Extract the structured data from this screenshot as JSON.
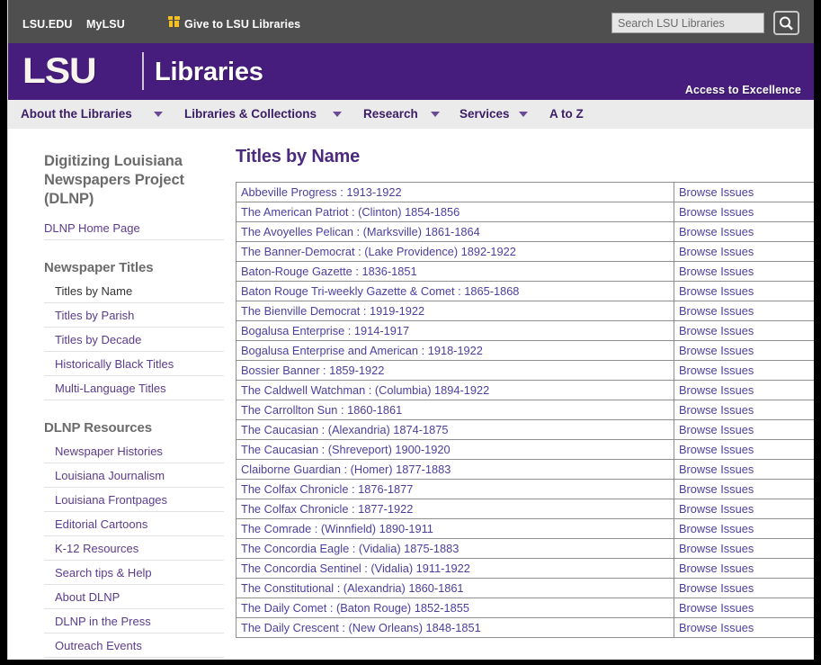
{
  "topbar": {
    "links": [
      {
        "label": "LSU.EDU",
        "name": "lsu-edu-link"
      },
      {
        "label": "MyLSU",
        "name": "mylsu-link"
      },
      {
        "label": "Give to LSU Libraries",
        "name": "give-link"
      }
    ],
    "search": {
      "placeholder": "Search LSU Libraries",
      "value": "",
      "button_icon": "search-icon"
    }
  },
  "brand": {
    "logo_text": "LSU",
    "logo_sub": "Libraries",
    "tagline": "Access to Excellence"
  },
  "mainnav": {
    "items": [
      {
        "label": "About the Libraries",
        "has_caret": true
      },
      {
        "label": "Libraries & Collections",
        "has_caret": true
      },
      {
        "label": "Research",
        "has_caret": true
      },
      {
        "label": "Services",
        "has_caret": true
      },
      {
        "label": "A to Z",
        "has_caret": false
      }
    ]
  },
  "sidebar": {
    "title": "Digitizing Louisiana Newspapers Project (DLNP)",
    "home_link": "DLNP Home Page",
    "groups": [
      {
        "heading": "Newspaper Titles",
        "items": [
          {
            "label": "Titles by Name",
            "active": true
          },
          {
            "label": "Titles by Parish",
            "active": false
          },
          {
            "label": "Titles by Decade",
            "active": false
          },
          {
            "label": "Historically Black Titles",
            "active": false
          },
          {
            "label": "Multi-Language Titles",
            "active": false
          }
        ]
      },
      {
        "heading": "DLNP Resources",
        "items": [
          {
            "label": "Newspaper Histories",
            "active": false
          },
          {
            "label": "Louisiana Journalism",
            "active": false
          },
          {
            "label": "Louisiana Frontpages",
            "active": false
          },
          {
            "label": "Editorial Cartoons",
            "active": false
          },
          {
            "label": "K-12 Resources",
            "active": false
          },
          {
            "label": "Search tips & Help",
            "active": false
          },
          {
            "label": "About DLNP",
            "active": false
          },
          {
            "label": "DLNP in the Press",
            "active": false
          },
          {
            "label": "Outreach Events",
            "active": false
          }
        ]
      }
    ]
  },
  "main": {
    "page_title": "Titles by Name",
    "browse_label": "Browse Issues",
    "rows": [
      {
        "title": "Abbeville Progress : 1913-1922"
      },
      {
        "title": "The American Patriot : (Clinton) 1854-1856"
      },
      {
        "title": "The Avoyelles Pelican : (Marksville) 1861-1864"
      },
      {
        "title": "The Banner-Democrat : (Lake Providence) 1892-1922"
      },
      {
        "title": "Baton-Rouge Gazette : 1836-1851"
      },
      {
        "title": "Baton Rouge Tri-weekly Gazette & Comet : 1865-1868"
      },
      {
        "title": "The Bienville Democrat : 1919-1922"
      },
      {
        "title": "Bogalusa Enterprise : 1914-1917"
      },
      {
        "title": "Bogalusa Enterprise and American : 1918-1922"
      },
      {
        "title": "Bossier Banner : 1859-1922"
      },
      {
        "title": "The Caldwell Watchman : (Columbia) 1894-1922"
      },
      {
        "title": "The Carrollton Sun : 1860-1861"
      },
      {
        "title": "The Caucasian : (Alexandria) 1874-1875"
      },
      {
        "title": "The Caucasian : (Shreveport) 1900-1920"
      },
      {
        "title": "Claiborne Guardian : (Homer) 1877-1883"
      },
      {
        "title": "The Colfax Chronicle : 1876-1877"
      },
      {
        "title": "The Colfax Chronicle : 1877-1922"
      },
      {
        "title": "The Comrade : (Winnfield) 1890-1911"
      },
      {
        "title": "The Concordia Eagle : (Vidalia) 1875-1883"
      },
      {
        "title": "The Concordia Sentinel : (Vidalia) 1911-1922"
      },
      {
        "title": "The Constitutional : (Alexandria) 1860-1861"
      },
      {
        "title": "The Daily Comet : (Baton Rouge) 1852-1855"
      },
      {
        "title": "The Daily Crescent : (New Orleans) 1848-1851"
      }
    ]
  },
  "colors": {
    "brand_purple": "#461d7c",
    "link_purple": "#4b3f9e",
    "topbar_gray": "#4f4f4f",
    "nav_gray": "#ebebeb",
    "gift_gold": "#f8c01e"
  }
}
